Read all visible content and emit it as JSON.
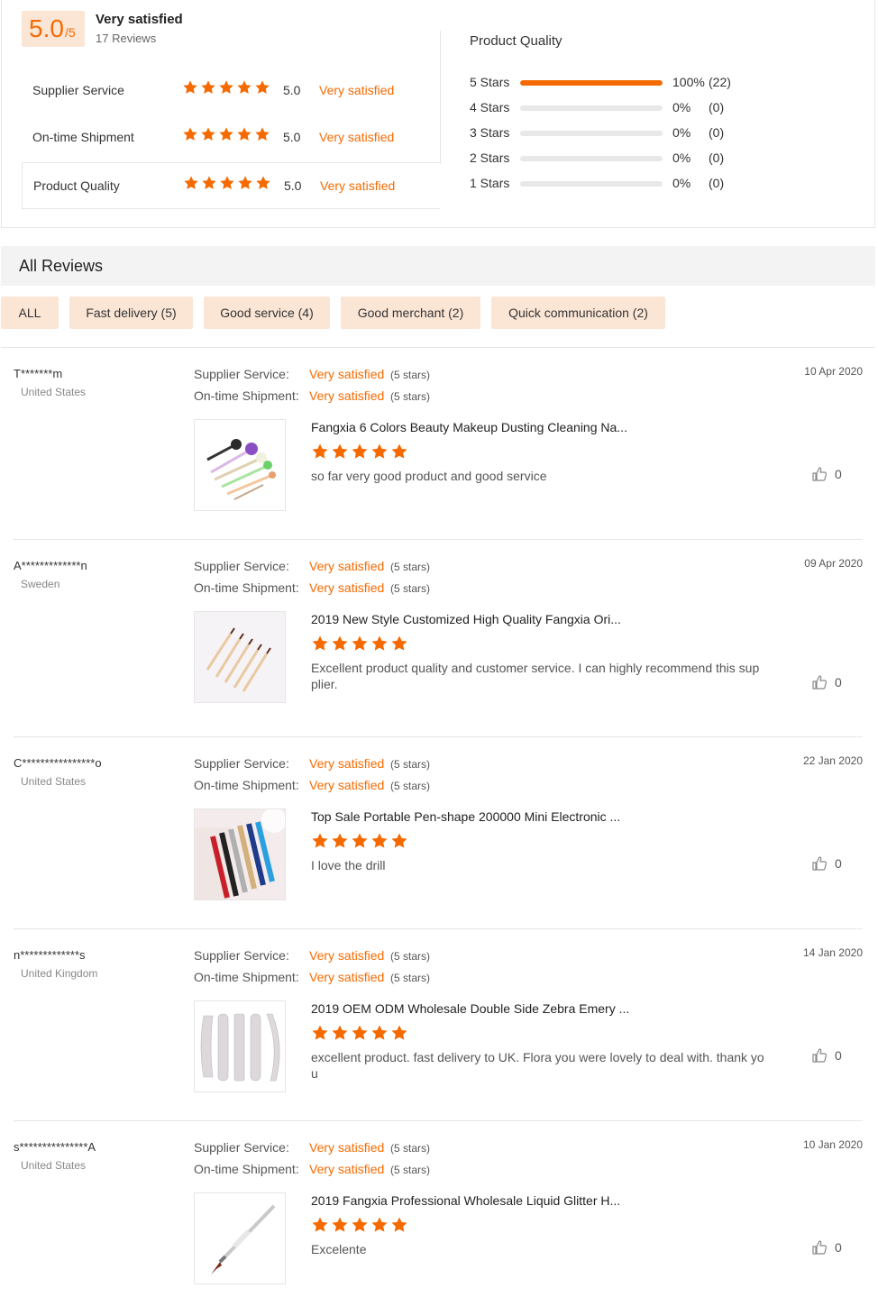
{
  "summary": {
    "score": "5.0",
    "score_suffix": "/5",
    "title": "Very satisfied",
    "reviews": "17 Reviews",
    "metrics": [
      {
        "label": "Supplier Service",
        "value": "5.0",
        "text": "Very satisfied",
        "stars": 5
      },
      {
        "label": "On-time Shipment",
        "value": "5.0",
        "text": "Very satisfied",
        "stars": 5
      },
      {
        "label": "Product Quality",
        "value": "5.0",
        "text": "Very satisfied",
        "stars": 5
      }
    ],
    "product_quality_title": "Product Quality",
    "distribution": [
      {
        "label": "5 Stars",
        "pct": "100%",
        "count": "(22)",
        "fraction": 1.0
      },
      {
        "label": "4 Stars",
        "pct": "0%",
        "count": "(0)",
        "fraction": 0
      },
      {
        "label": "3 Stars",
        "pct": "0%",
        "count": "(0)",
        "fraction": 0
      },
      {
        "label": "2 Stars",
        "pct": "0%",
        "count": "(0)",
        "fraction": 0
      },
      {
        "label": "1 Stars",
        "pct": "0%",
        "count": "(0)",
        "fraction": 0
      }
    ]
  },
  "all_reviews": {
    "title": "All Reviews",
    "tags": [
      {
        "label": "ALL"
      },
      {
        "label": "Fast delivery (5)"
      },
      {
        "label": "Good service (4)"
      },
      {
        "label": "Good merchant (2)"
      },
      {
        "label": "Quick communication (2)"
      }
    ],
    "supplier_label": "Supplier Service:",
    "shipment_label": "On-time Shipment:",
    "items": [
      {
        "user": "T*******m",
        "country": "United States",
        "date": "10 Apr 2020",
        "supplier": "Very satisfied",
        "supplier_stars": "(5 stars)",
        "shipment": "Very satisfied",
        "shipment_stars": "(5 stars)",
        "product": "Fangxia 6 Colors Beauty Makeup Dusting Cleaning Na...",
        "rating": 5,
        "comment": "so far very good product and good service",
        "likes": "0",
        "thumb_icon": "makeup-brushes"
      },
      {
        "user": "A*************n",
        "country": "Sweden",
        "date": "09 Apr 2020",
        "supplier": "Very satisfied",
        "supplier_stars": "(5 stars)",
        "shipment": "Very satisfied",
        "shipment_stars": "(5 stars)",
        "product": "2019 New Style Customized High Quality Fangxia Ori...",
        "rating": 5,
        "comment": "Excellent product quality and customer service. I can highly recommend this supplier.",
        "likes": "0",
        "thumb_icon": "nail-art-brushes"
      },
      {
        "user": "C****************o",
        "country": "United States",
        "date": "22 Jan 2020",
        "supplier": "Very satisfied",
        "supplier_stars": "(5 stars)",
        "shipment": "Very satisfied",
        "shipment_stars": "(5 stars)",
        "product": "Top Sale Portable Pen-shape 200000 Mini Electronic ...",
        "rating": 5,
        "comment": "I love the drill",
        "likes": "0",
        "thumb_icon": "pen-drills"
      },
      {
        "user": "n*************s",
        "country": "United Kingdom",
        "date": "14 Jan 2020",
        "supplier": "Very satisfied",
        "supplier_stars": "(5 stars)",
        "shipment": "Very satisfied",
        "shipment_stars": "(5 stars)",
        "product": "2019 OEM ODM Wholesale Double Side Zebra Emery ...",
        "rating": 5,
        "comment": "excellent product. fast delivery to UK. Flora you were lovely to deal with. thank you",
        "likes": "0",
        "thumb_icon": "nail-files"
      },
      {
        "user": "s***************A",
        "country": "United States",
        "date": "10 Jan 2020",
        "supplier": "Very satisfied",
        "supplier_stars": "(5 stars)",
        "shipment": "Very satisfied",
        "shipment_stars": "(5 stars)",
        "product": "2019 Fangxia Professional Wholesale Liquid Glitter H...",
        "rating": 5,
        "comment": "Excelente",
        "likes": "0",
        "thumb_icon": "glitter-brush"
      }
    ]
  },
  "colors": {
    "accent": "#f56a00",
    "tag_bg": "#fbe6d6",
    "header_bg": "#f3f3f3",
    "divider": "#e6e6e6"
  }
}
